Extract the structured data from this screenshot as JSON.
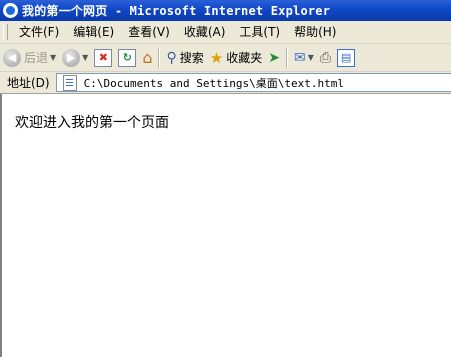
{
  "window": {
    "title": "我的第一个网页 - Microsoft Internet Explorer"
  },
  "menu": {
    "items": [
      {
        "label": "文件(F)"
      },
      {
        "label": "编辑(E)"
      },
      {
        "label": "查看(V)"
      },
      {
        "label": "收藏(A)"
      },
      {
        "label": "工具(T)"
      },
      {
        "label": "帮助(H)"
      }
    ]
  },
  "toolbar": {
    "back_label": "后退",
    "search_label": "搜索",
    "favorites_label": "收藏夹"
  },
  "address": {
    "label": "地址(D)",
    "value": "C:\\Documents and Settings\\桌面\\text.html"
  },
  "page": {
    "body_text": "欢迎进入我的第一个页面"
  }
}
